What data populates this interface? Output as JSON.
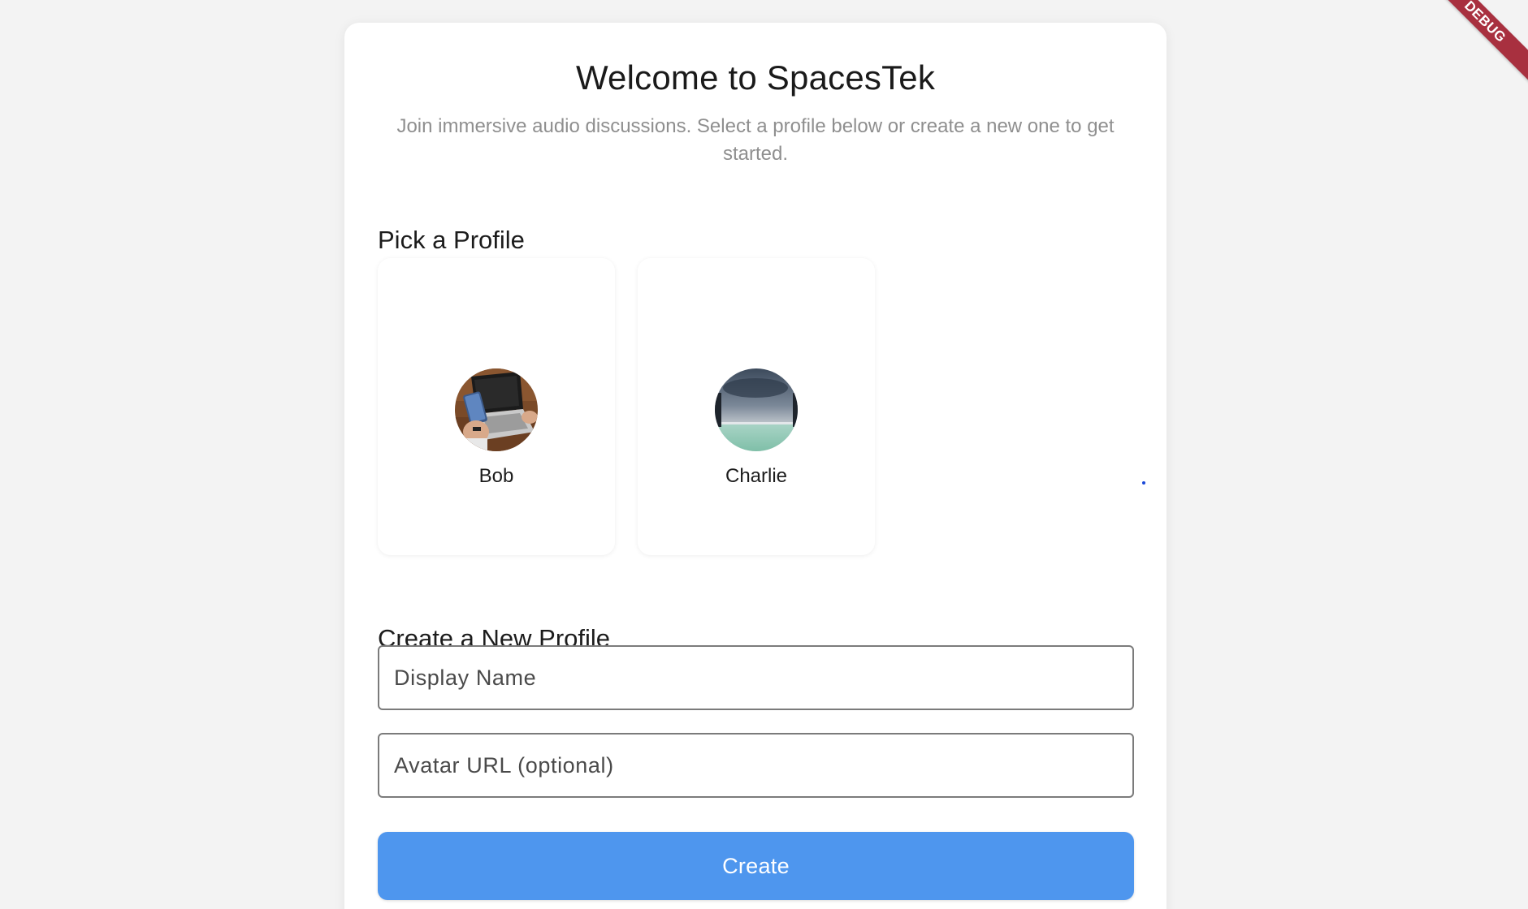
{
  "header": {
    "title": "Welcome to SpacesTek",
    "subtitle": "Join immersive audio discussions. Select a profile below or create a new one to get started."
  },
  "pick_profile": {
    "heading": "Pick a Profile",
    "profiles": [
      {
        "name": "Bob",
        "avatar": "laptop-photo"
      },
      {
        "name": "Charlie",
        "avatar": "sea-sky-photo"
      }
    ]
  },
  "create_profile": {
    "heading": "Create a New Profile",
    "display_name": {
      "value": "",
      "placeholder": "Display Name"
    },
    "avatar_url": {
      "value": "",
      "placeholder": "Avatar URL (optional)"
    },
    "button_label": "Create"
  },
  "debug_banner": {
    "label": "DEBUG"
  },
  "colors": {
    "background": "#f3f3f3",
    "card": "#ffffff",
    "button": "#4e96ee",
    "subtitle_text": "#8f8f8f",
    "debug_banner": "#a8303f"
  }
}
